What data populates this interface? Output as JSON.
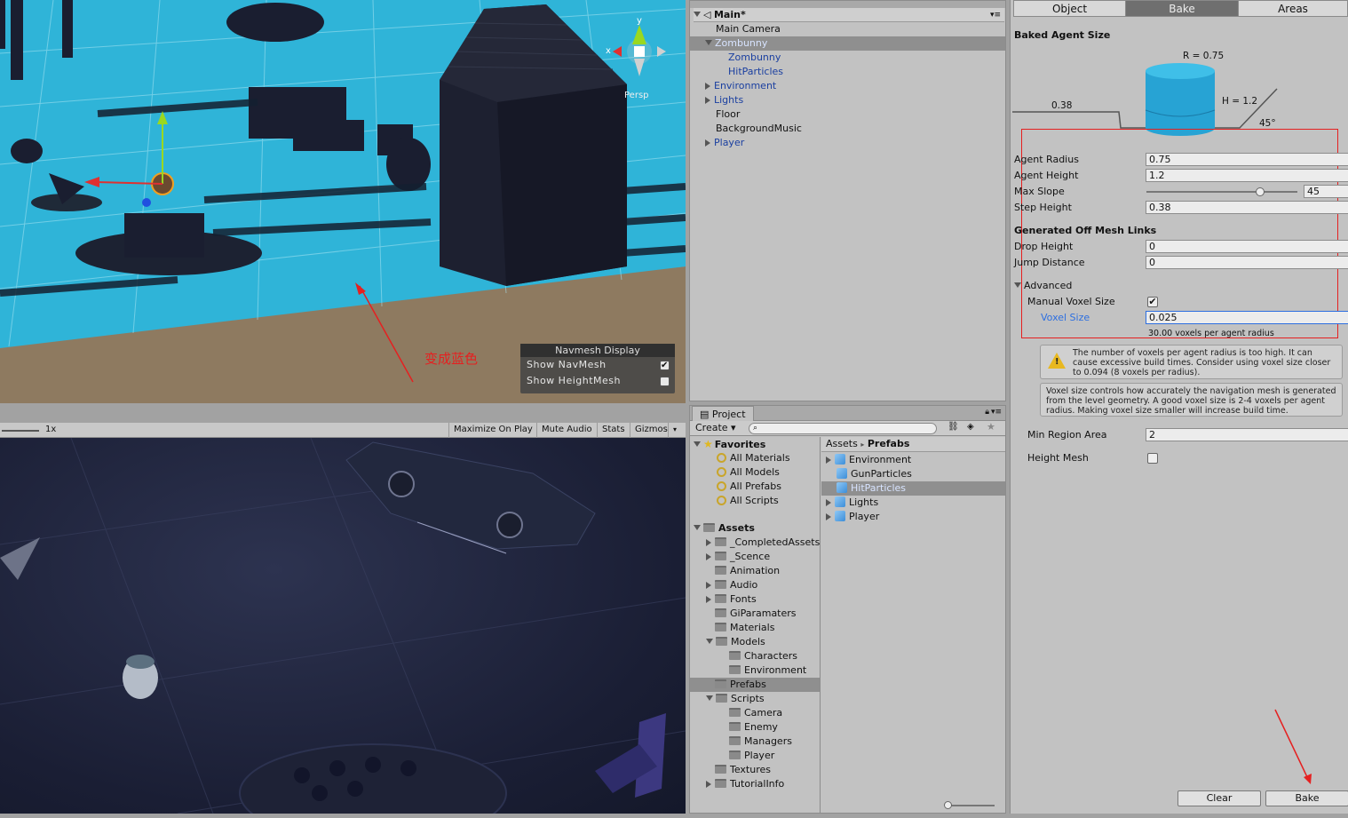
{
  "scene": {
    "navmesh_display": {
      "title": "Navmesh Display",
      "show_navmesh": "Show NavMesh",
      "show_heightmesh": "Show HeightMesh"
    },
    "annotation": "变成蓝色",
    "gizmos": "Gizmos",
    "persp": "Persp",
    "axis_x": "x",
    "axis_y": "y"
  },
  "game_toolbar": {
    "scale": "1x",
    "maximize": "Maximize On Play",
    "mute": "Mute Audio",
    "stats": "Stats",
    "gizmos": "Gizmos"
  },
  "hierarchy": {
    "scene_name": "Main*",
    "items": [
      {
        "label": "Main Camera"
      },
      {
        "label": "Zombunny"
      },
      {
        "label": "Zombunny"
      },
      {
        "label": "HitParticles"
      },
      {
        "label": "Environment"
      },
      {
        "label": "Lights"
      },
      {
        "label": "Floor"
      },
      {
        "label": "BackgroundMusic"
      },
      {
        "label": "Player"
      }
    ]
  },
  "project": {
    "tab": "Project",
    "create": "Create",
    "favorites": "Favorites",
    "fav_items": [
      "All Materials",
      "All Models",
      "All Prefabs",
      "All Scripts"
    ],
    "assets": "Assets",
    "asset_folders": [
      "_CompletedAssets",
      "_Scence",
      "Animation",
      "Audio",
      "Fonts",
      "GiParamaters",
      "Materials",
      "Models",
      "Characters",
      "Environment",
      "Prefabs",
      "Scripts",
      "Camera",
      "Enemy",
      "Managers",
      "Player",
      "Textures",
      "TutorialInfo"
    ],
    "breadcrumb_root": "Assets",
    "breadcrumb_sep": "▸",
    "breadcrumb_current": "Prefabs",
    "prefabs": [
      "Environment",
      "GunParticles",
      "HitParticles",
      "Lights",
      "Player"
    ]
  },
  "inspector": {
    "tabs": [
      "Object",
      "Bake",
      "Areas"
    ],
    "baked_agent_size": "Baked Agent Size",
    "diagram": {
      "r": "R = 0.75",
      "h": "H = 1.2",
      "step": "0.38",
      "slope": "45°"
    },
    "agent_radius": {
      "label": "Agent Radius",
      "value": "0.75"
    },
    "agent_height": {
      "label": "Agent Height",
      "value": "1.2"
    },
    "max_slope": {
      "label": "Max Slope",
      "value": "45",
      "fraction": 0.75
    },
    "step_height": {
      "label": "Step Height",
      "value": "0.38"
    },
    "offmesh_header": "Generated Off Mesh Links",
    "drop_height": {
      "label": "Drop Height",
      "value": "0"
    },
    "jump_distance": {
      "label": "Jump Distance",
      "value": "0"
    },
    "advanced": "Advanced",
    "manual_voxel": "Manual Voxel Size",
    "voxel_size": {
      "label": "Voxel Size",
      "value": "0.025"
    },
    "voxels_per_radius": "30.00 voxels per agent radius",
    "warning": "The number of voxels per agent radius is too high. It can cause excessive build times. Consider using voxel size closer to 0.094 (8 voxels per radius).",
    "info": "Voxel size controls how accurately the navigation mesh is generated from the level geometry. A good voxel size is 2-4 voxels per agent radius. Making voxel size smaller will increase build time.",
    "min_region": {
      "label": "Min Region Area",
      "value": "2"
    },
    "height_mesh": "Height Mesh",
    "clear": "Clear",
    "bake": "Bake"
  },
  "colors": {
    "navmesh": "#2bb3d6",
    "annotation": "#e52020",
    "highlight": "#2d6fe0"
  }
}
